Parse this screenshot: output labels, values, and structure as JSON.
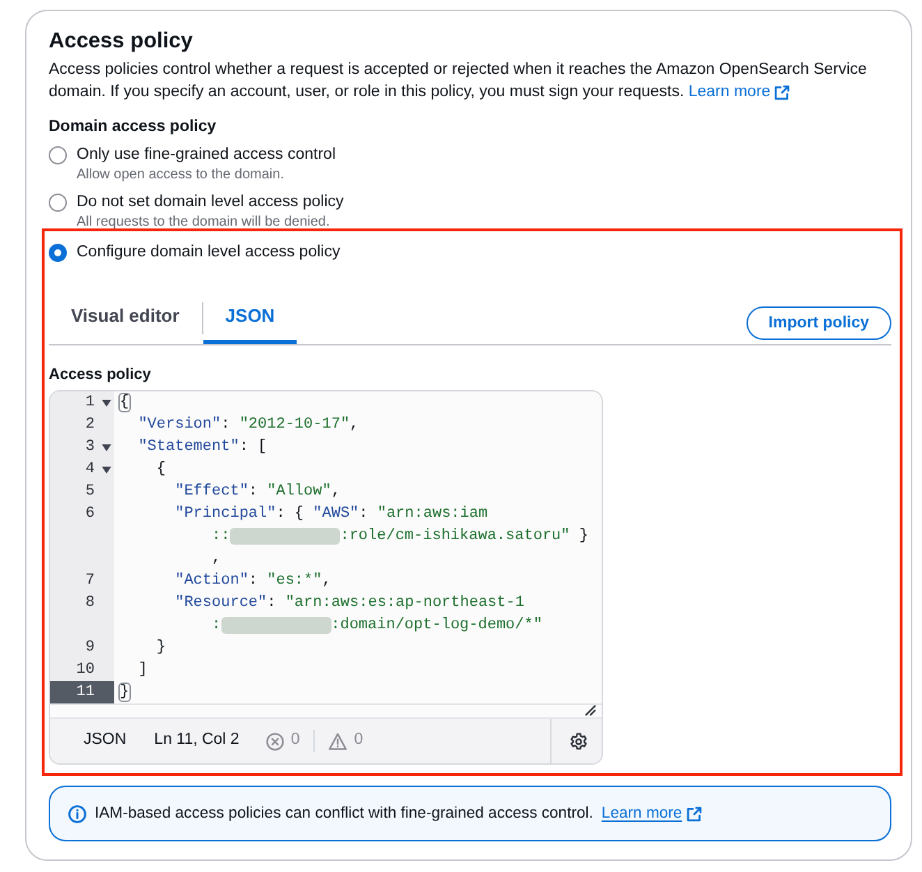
{
  "access_policy_section": {
    "title": "Access policy",
    "description": "Access policies control whether a request is accepted or rejected when it reaches the Amazon OpenSearch Service domain. If you specify an account, user, or role in this policy, you must sign your requests.",
    "learn_more_link": "Learn more"
  },
  "domain_access_policy": {
    "label": "Domain access policy",
    "options": [
      {
        "label": "Only use fine-grained access control",
        "description": "Allow open access to the domain.",
        "selected": false
      },
      {
        "label": "Do not set domain level access policy",
        "description": "All requests to the domain will be denied.",
        "selected": false
      },
      {
        "label": "Configure domain level access policy",
        "selected": true
      }
    ]
  },
  "policy_editor": {
    "tabs": [
      {
        "label": "Visual editor",
        "selected": false
      },
      {
        "label": "JSON",
        "selected": true
      }
    ],
    "import_button": "Import policy",
    "field_label": "Access policy",
    "lines": [
      {
        "number": "1",
        "fold": true,
        "active": false,
        "rows": [
          {
            "tokens": [
              {
                "kind": "matched_bracket",
                "text": "{"
              }
            ]
          }
        ]
      },
      {
        "number": "2",
        "fold": false,
        "active": false,
        "rows": [
          {
            "tokens": [
              {
                "kind": "key",
                "text": "  \"Version\""
              },
              {
                "kind": "punct",
                "text": ": "
              },
              {
                "kind": "string",
                "text": "\"2012-10-17\""
              },
              {
                "kind": "punct",
                "text": ","
              }
            ]
          }
        ]
      },
      {
        "number": "3",
        "fold": true,
        "active": false,
        "rows": [
          {
            "tokens": [
              {
                "kind": "key",
                "text": "  \"Statement\""
              },
              {
                "kind": "punct",
                "text": ": ["
              }
            ]
          }
        ]
      },
      {
        "number": "4",
        "fold": true,
        "active": false,
        "rows": [
          {
            "tokens": [
              {
                "kind": "punct",
                "text": "    {"
              }
            ]
          }
        ]
      },
      {
        "number": "5",
        "fold": false,
        "active": false,
        "rows": [
          {
            "tokens": [
              {
                "kind": "key",
                "text": "      \"Effect\""
              },
              {
                "kind": "punct",
                "text": ": "
              },
              {
                "kind": "string",
                "text": "\"Allow\""
              },
              {
                "kind": "punct",
                "text": ","
              }
            ]
          }
        ]
      },
      {
        "number": "6",
        "fold": false,
        "active": false,
        "rows": [
          {
            "tokens": [
              {
                "kind": "key",
                "text": "      \"Principal\""
              },
              {
                "kind": "punct",
                "text": ": { "
              },
              {
                "kind": "key",
                "text": "\"AWS\""
              },
              {
                "kind": "punct",
                "text": ": "
              },
              {
                "kind": "string",
                "text": "\"arn:aws:iam"
              }
            ]
          },
          {
            "tokens": [
              {
                "kind": "string",
                "text": "          ::"
              },
              {
                "kind": "redacted"
              },
              {
                "kind": "string",
                "text": ":role/cm-ishikawa.satoru\""
              },
              {
                "kind": "punct",
                "text": " }"
              }
            ]
          },
          {
            "tokens": [
              {
                "kind": "punct",
                "text": "          ,"
              }
            ]
          }
        ]
      },
      {
        "number": "7",
        "fold": false,
        "active": false,
        "rows": [
          {
            "tokens": [
              {
                "kind": "key",
                "text": "      \"Action\""
              },
              {
                "kind": "punct",
                "text": ": "
              },
              {
                "kind": "string",
                "text": "\"es:*\""
              },
              {
                "kind": "punct",
                "text": ","
              }
            ]
          }
        ]
      },
      {
        "number": "8",
        "fold": false,
        "active": false,
        "rows": [
          {
            "tokens": [
              {
                "kind": "key",
                "text": "      \"Resource\""
              },
              {
                "kind": "punct",
                "text": ": "
              },
              {
                "kind": "string",
                "text": "\"arn:aws:es:ap-northeast-1"
              }
            ]
          },
          {
            "tokens": [
              {
                "kind": "string",
                "text": "          :"
              },
              {
                "kind": "redacted"
              },
              {
                "kind": "string",
                "text": ":domain/opt-log-demo/*\""
              }
            ]
          }
        ]
      },
      {
        "number": "9",
        "fold": false,
        "active": false,
        "rows": [
          {
            "tokens": [
              {
                "kind": "punct",
                "text": "    }"
              }
            ]
          }
        ]
      },
      {
        "number": "10",
        "fold": false,
        "active": false,
        "rows": [
          {
            "tokens": [
              {
                "kind": "punct",
                "text": "  ]"
              }
            ]
          }
        ]
      },
      {
        "number": "11",
        "fold": false,
        "active": true,
        "rows": [
          {
            "tokens": [
              {
                "kind": "matched_bracket",
                "text": "}"
              }
            ]
          }
        ]
      }
    ],
    "status_bar": {
      "language": "JSON",
      "cursor_position": "Ln 11, Col 2",
      "error_count": "0",
      "warning_count": "0"
    }
  },
  "info_alert": {
    "text": "IAM-based access policies can conflict with fine-grained access control.",
    "link": "Learn more"
  }
}
